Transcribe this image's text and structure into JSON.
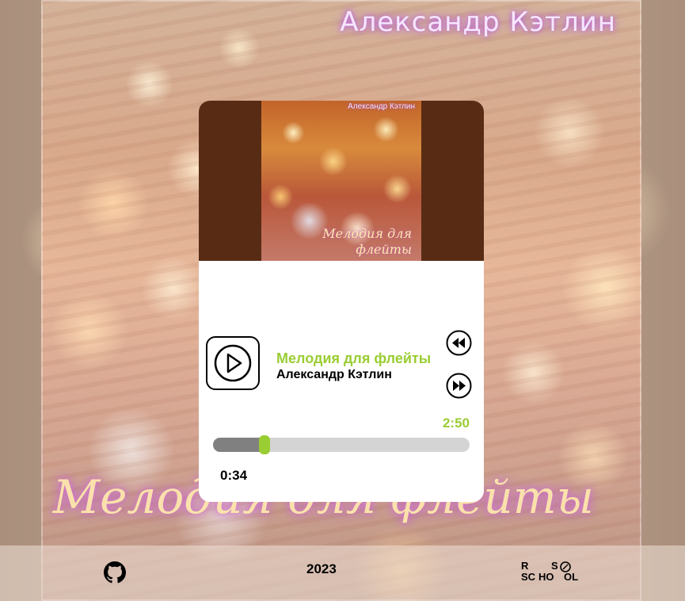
{
  "header": {
    "artist": "Александр Кэтлин"
  },
  "background": {
    "title": "Мелодия для флейты"
  },
  "player": {
    "cover": {
      "artist": "Александр Кэтлин",
      "title": "Мелодия для флейты"
    },
    "track": {
      "title": "Мелодия для флейты",
      "artist": "Александр Кэтлин"
    },
    "duration": "2:50",
    "current_time": "0:34",
    "progress_fraction": 0.2,
    "icons": {
      "play": "play-icon",
      "previous": "rewind-icon",
      "next": "fast-forward-icon"
    },
    "colors": {
      "accent": "#9acd32",
      "cover_bg": "#582c14",
      "progress_fill": "#808080",
      "progress_track": "#d4d4d4"
    }
  },
  "footer": {
    "year": "2023",
    "github_icon": "github-icon",
    "school_logo": "rs-school-logo"
  }
}
